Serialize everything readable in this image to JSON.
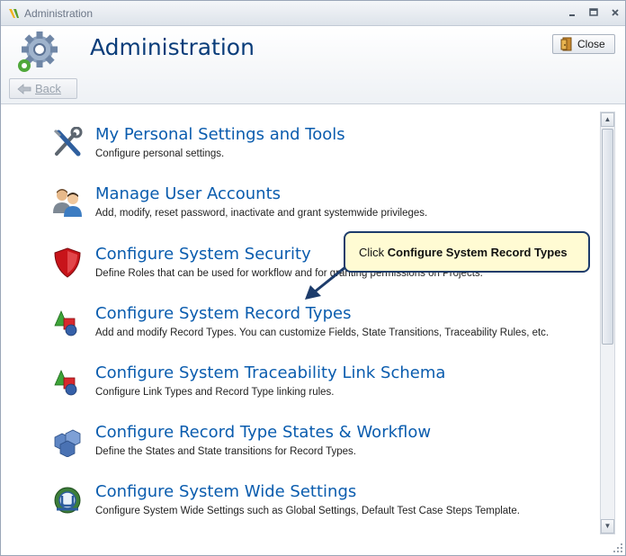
{
  "window": {
    "title": "Administration"
  },
  "header": {
    "title": "Administration",
    "close_label": "Close",
    "back_label": "Back"
  },
  "items": [
    {
      "title": "My Personal Settings and Tools",
      "description": "Configure personal settings.",
      "icon": "tools-icon"
    },
    {
      "title": "Manage User Accounts",
      "description": "Add, modify, reset password, inactivate and grant systemwide privileges.",
      "icon": "users-icon"
    },
    {
      "title": "Configure System Security",
      "description": "Define Roles that can be used for workflow and for granting permissions on Projects.",
      "icon": "shield-icon"
    },
    {
      "title": "Configure System Record Types",
      "description": "Add and modify Record Types. You can customize Fields, State Transitions, Traceability Rules, etc.",
      "icon": "shapes-icon"
    },
    {
      "title": "Configure System Traceability Link Schema",
      "description": "Configure Link Types and Record Type linking rules.",
      "icon": "shapes-icon"
    },
    {
      "title": "Configure Record Type States & Workflow",
      "description": "Define the States and State transitions for Record Types.",
      "icon": "cubes-icon"
    },
    {
      "title": "Configure System Wide Settings",
      "description": "Configure System Wide Settings such as Global Settings, Default Test Case Steps Template.",
      "icon": "globe-settings-icon"
    }
  ],
  "callout": {
    "prefix": "Click",
    "target": "Configure System Record Types"
  },
  "colors": {
    "link_blue": "#0a5cae",
    "title_blue": "#0a3d7a",
    "callout_bg": "#fffbd3",
    "callout_border": "#1d3c6b"
  }
}
